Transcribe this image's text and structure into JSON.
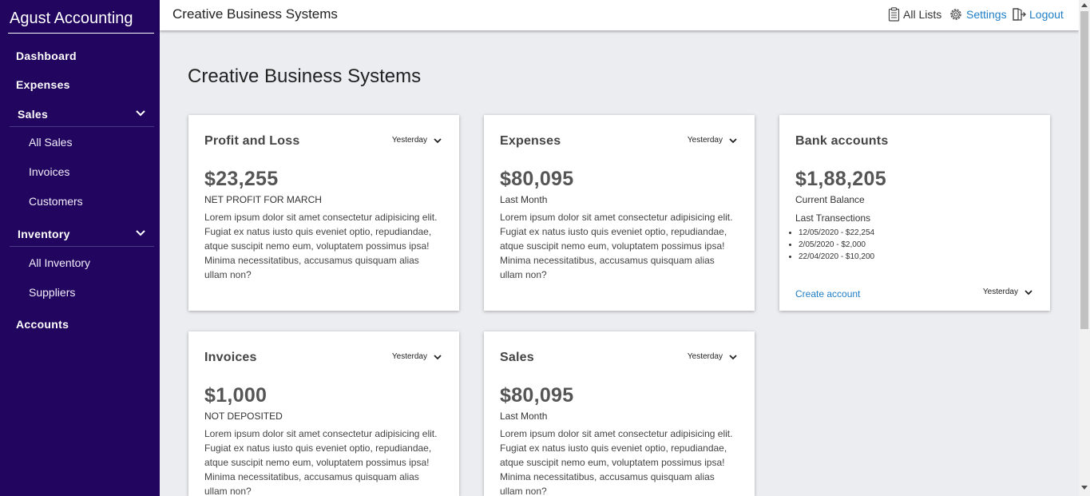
{
  "sidebar": {
    "brand": "Agust Accounting",
    "dashboard": "Dashboard",
    "expenses": "Expenses",
    "sales": {
      "label": "Sales",
      "items": [
        "All Sales",
        "Invoices",
        "Customers"
      ]
    },
    "inventory": {
      "label": "Inventory",
      "items": [
        "All Inventory",
        "Suppliers"
      ]
    },
    "accounts": "Accounts"
  },
  "topbar": {
    "title": "Creative Business Systems",
    "all_lists": "All Lists",
    "settings": "Settings",
    "logout": "Logout"
  },
  "page": {
    "title": "Creative Business Systems"
  },
  "cards": {
    "profit": {
      "title": "Profit and Loss",
      "period": "Yesterday",
      "amount": "$23,255",
      "sub": "NET PROFIT FOR MARCH",
      "desc": "Lorem ipsum dolor sit amet consectetur adipisicing elit. Fugiat ex natus iusto quis eveniet optio, repudiandae, atque suscipit nemo eum, voluptatem possimus ipsa! Minima necessitatibus, accusamus quisquam alias ullam non?"
    },
    "expenses": {
      "title": "Expenses",
      "period": "Yesterday",
      "amount": "$80,095",
      "sub": "Last Month",
      "desc": "Lorem ipsum dolor sit amet consectetur adipisicing elit. Fugiat ex natus iusto quis eveniet optio, repudiandae, atque suscipit nemo eum, voluptatem possimus ipsa! Minima necessitatibus, accusamus quisquam alias ullam non?"
    },
    "bank": {
      "title": "Bank accounts",
      "amount": "$1,88,205",
      "sub": "Current Balance",
      "sub2": "Last Transections",
      "transactions": [
        "12/05/2020 - $22,254",
        "2/05/2020 - $2,000",
        "22/04/2020 - $10,200"
      ],
      "create": "Create account",
      "period": "Yesterday"
    },
    "invoices": {
      "title": "Invoices",
      "period": "Yesterday",
      "amount": "$1,000",
      "sub": "NOT DEPOSITED",
      "desc": "Lorem ipsum dolor sit amet consectetur adipisicing elit. Fugiat ex natus iusto quis eveniet optio, repudiandae, atque suscipit nemo eum, voluptatem possimus ipsa! Minima necessitatibus, accusamus quisquam alias ullam non?"
    },
    "sales": {
      "title": "Sales",
      "period": "Yesterday",
      "amount": "$80,095",
      "sub": "Last Month",
      "desc": "Lorem ipsum dolor sit amet consectetur adipisicing elit. Fugiat ex natus iusto quis eveniet optio, repudiandae, atque suscipit nemo eum, voluptatem possimus ipsa! Minima necessitatibus, accusamus quisquam alias ullam non?"
    }
  },
  "icons": {
    "chevron": "chevron-down-icon",
    "clipboard": "clipboard-icon",
    "gear": "gear-icon",
    "logout": "logout-icon"
  },
  "colors": {
    "sidebar": "#22055f",
    "link": "#1f7ec6",
    "background": "#ecedf1"
  }
}
